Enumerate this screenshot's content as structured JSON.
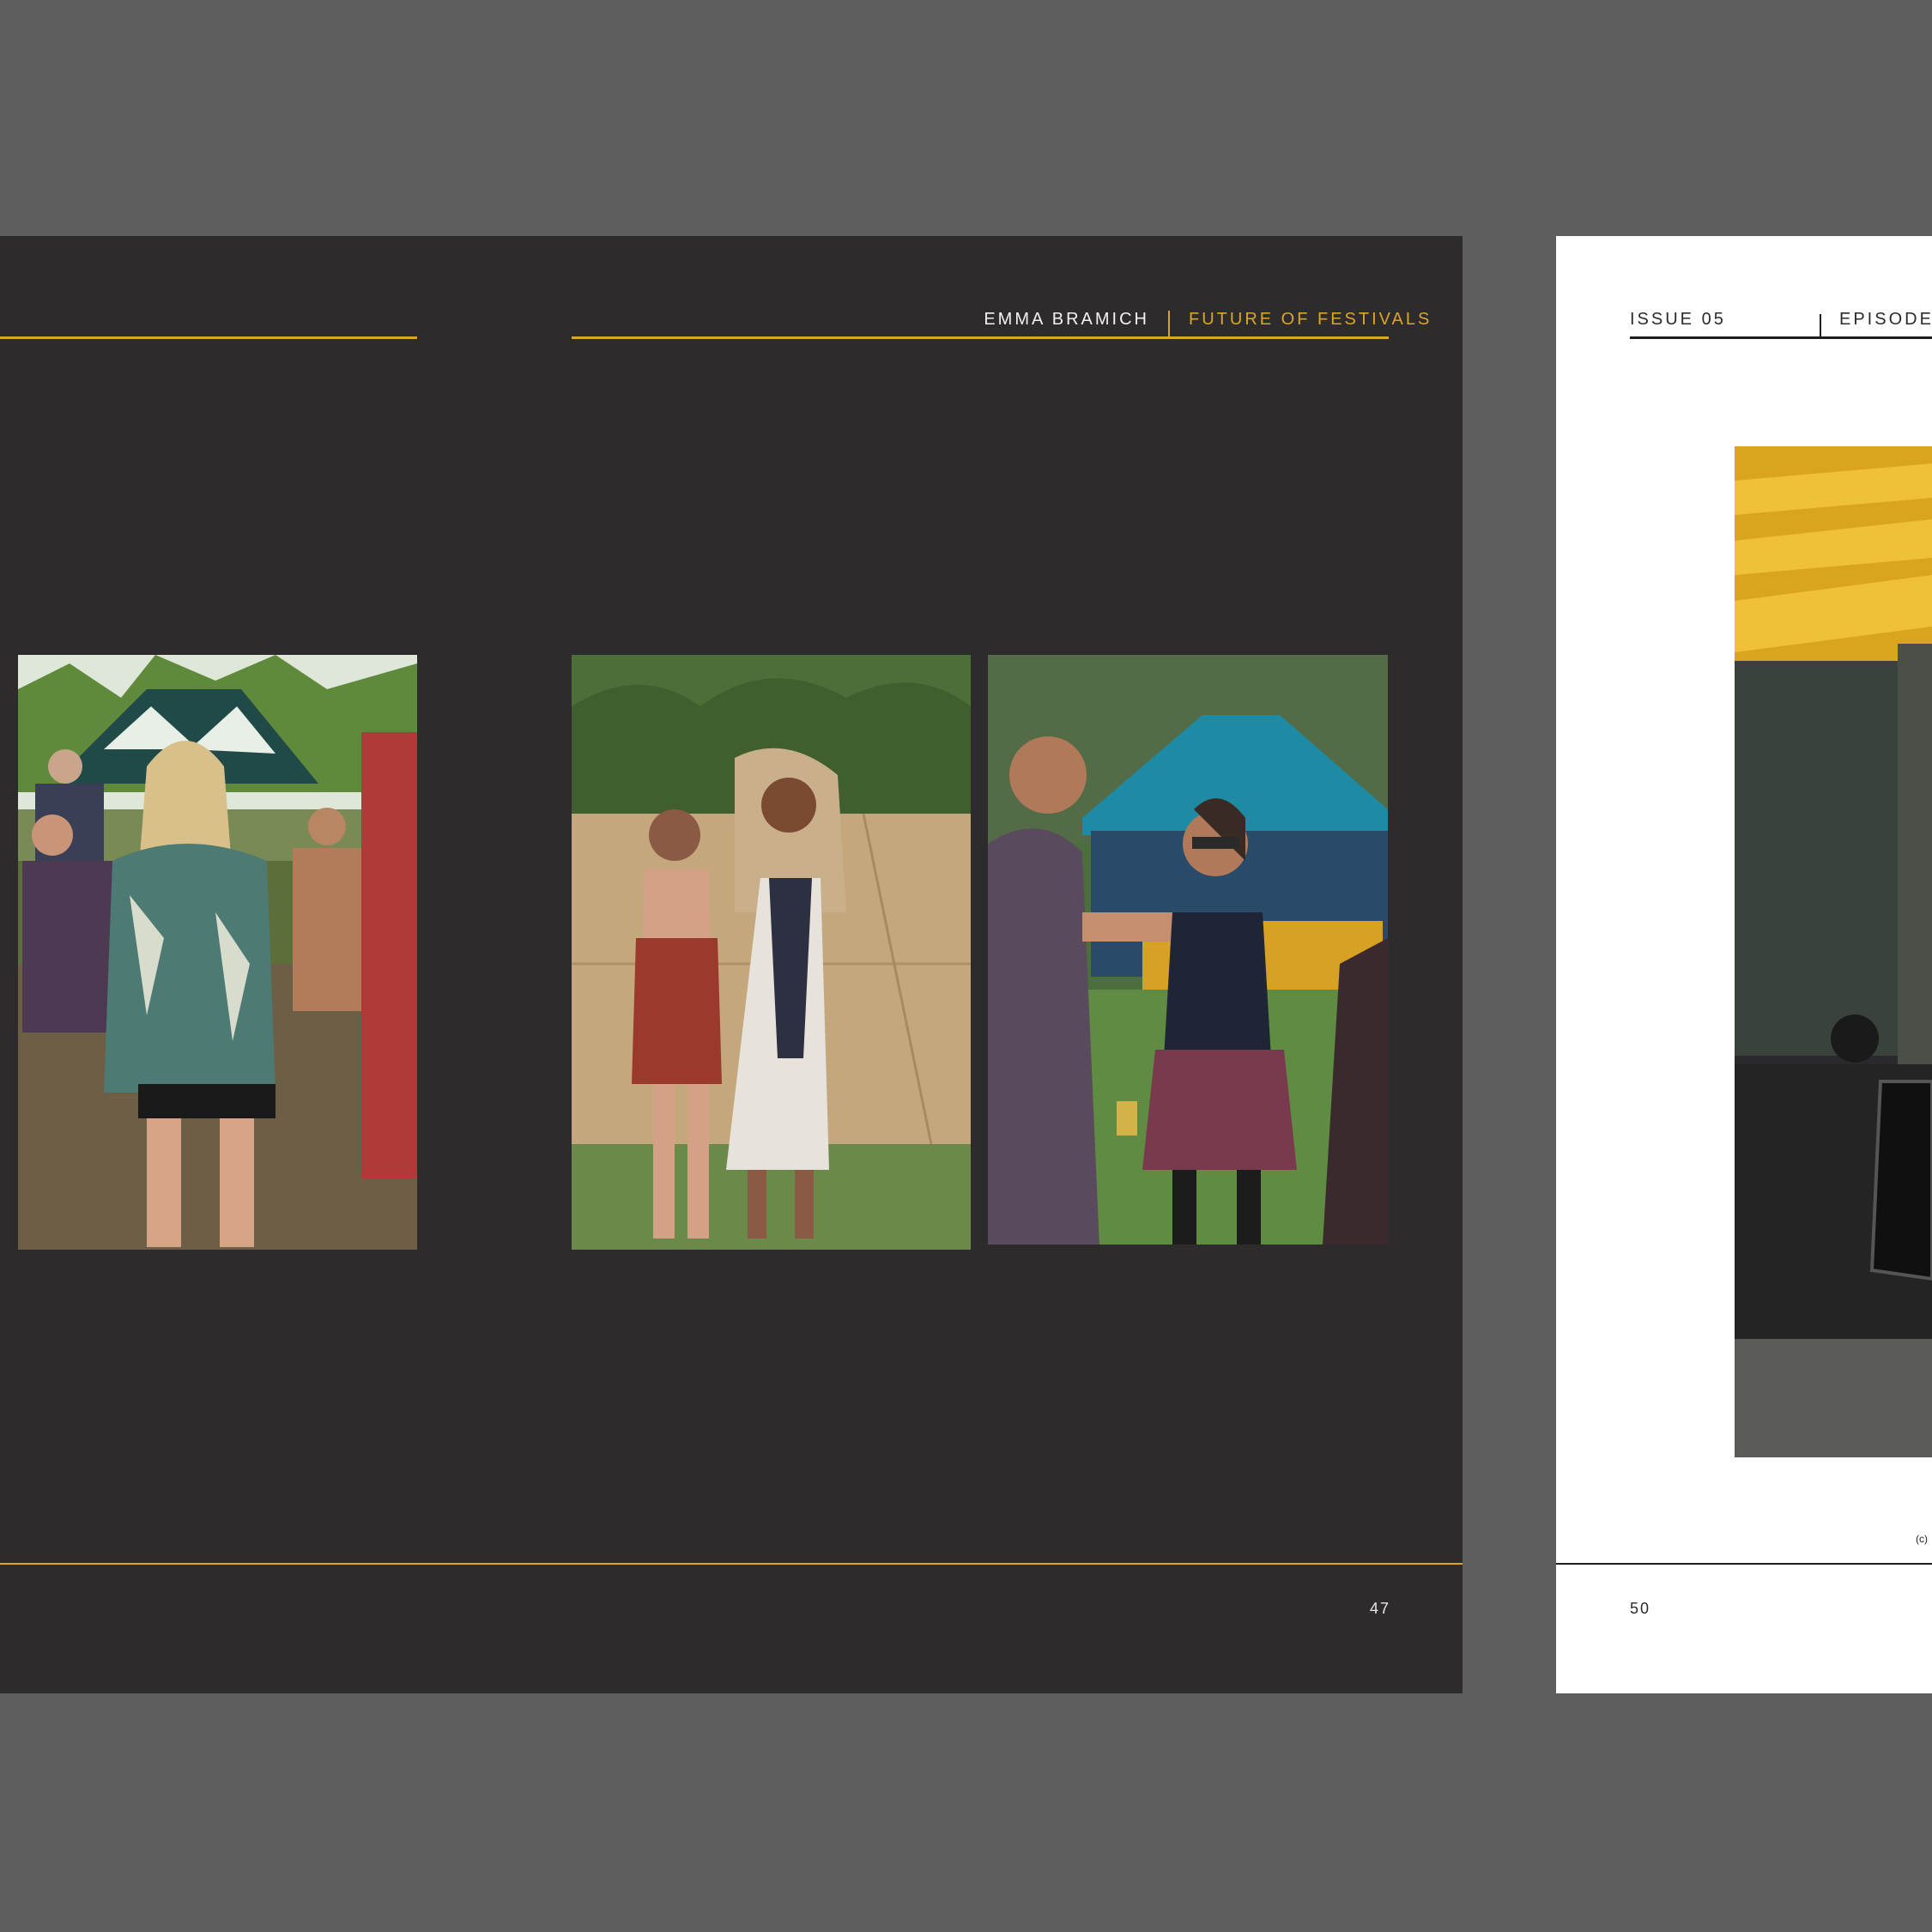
{
  "left_spread": {
    "header": {
      "author": "EMMA BRAMICH",
      "section": "FUTURE OF FESTIVALS"
    },
    "page_number": "47",
    "photos": [
      {
        "name": "photo-woman-crowd",
        "subject": "festival crowd, woman in patterned shirt"
      },
      {
        "name": "photo-two-women-tent",
        "subject": "two women near hessian fence, one with teddy bear"
      },
      {
        "name": "photo-woman-blue-tent",
        "subject": "woman in sunglasses by blue marquee"
      }
    ]
  },
  "right_spread": {
    "header": {
      "issue": "ISSUE 05",
      "episode": "EPISODE S"
    },
    "page_number": "50",
    "photo": {
      "name": "photo-bins",
      "subject": "row of yellow-lidded wheelie bins"
    },
    "credit_mark": "(c)"
  },
  "colors": {
    "page_dark": "#2e2b2d",
    "accent_gold": "#d9a62a",
    "background": "#5e5e5e"
  }
}
